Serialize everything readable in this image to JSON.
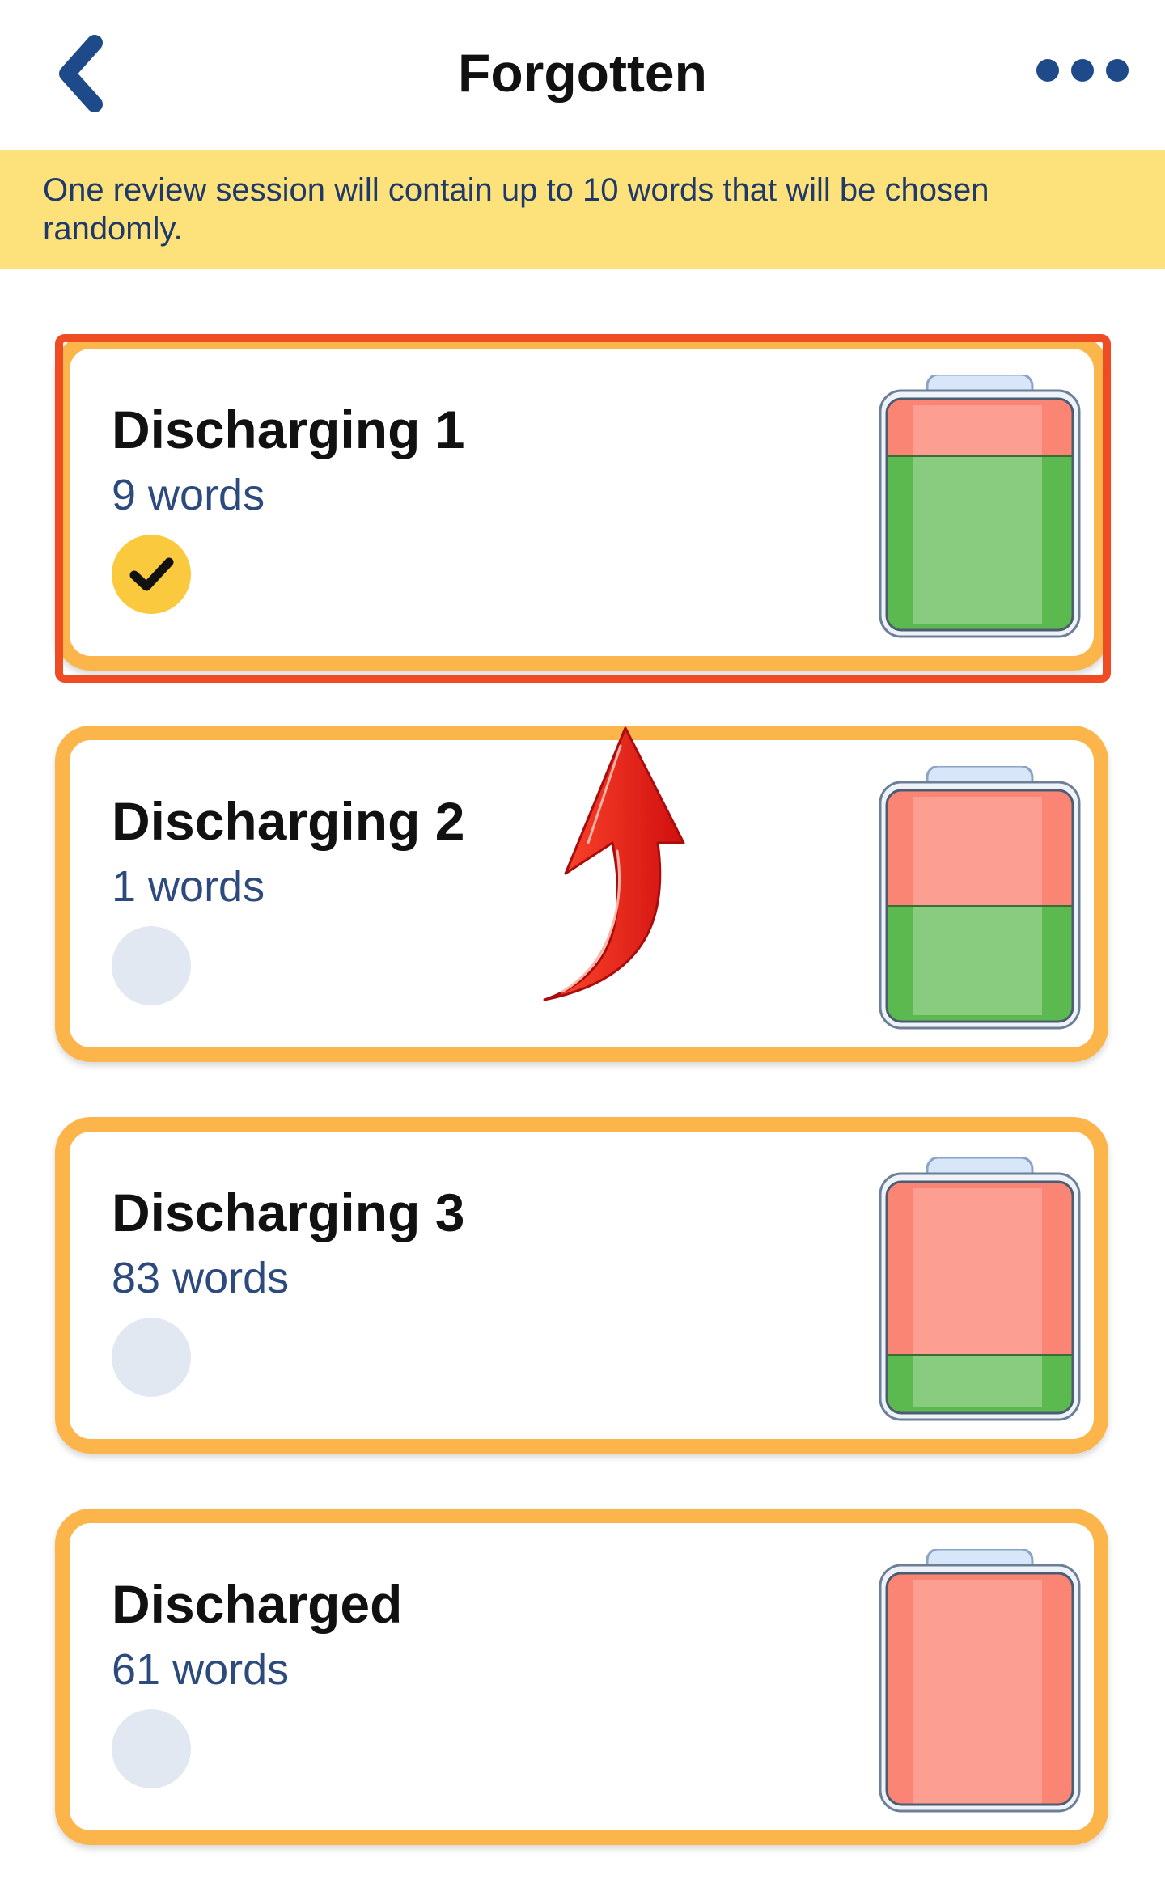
{
  "header": {
    "title": "Forgotten",
    "back_icon": "chevron-left-icon",
    "more_icon": "more-horizontal-icon"
  },
  "banner": {
    "text": "One review session will contain up to 10 words that will be chosen randomly."
  },
  "colors": {
    "accent_border": "#fcb54a",
    "banner_bg": "#fde27b",
    "battery_green": "#5cb94f",
    "battery_red": "#fb8574",
    "check_yellow": "#fbc93d",
    "highlight_red": "#ef4c23"
  },
  "cards": [
    {
      "title": "Discharging 1",
      "count": "9 words",
      "checked": true,
      "charge_fraction": 0.75
    },
    {
      "title": "Discharging 2",
      "count": "1 words",
      "checked": false,
      "charge_fraction": 0.5
    },
    {
      "title": "Discharging 3",
      "count": "83 words",
      "checked": false,
      "charge_fraction": 0.25
    },
    {
      "title": "Discharged",
      "count": "61 words",
      "checked": false,
      "charge_fraction": 0
    }
  ]
}
